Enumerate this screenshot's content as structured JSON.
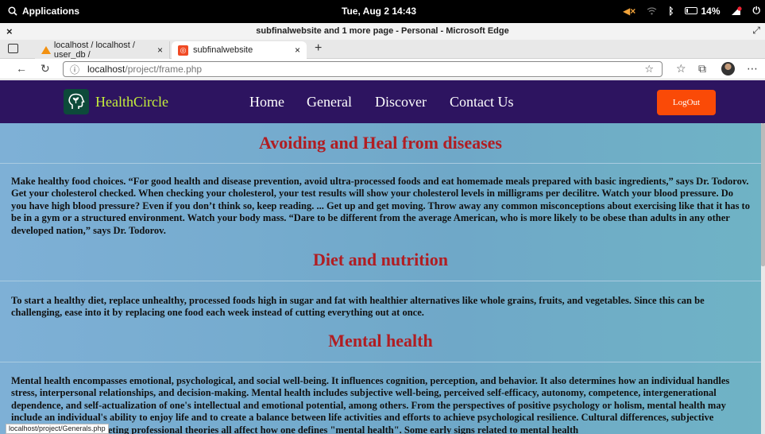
{
  "os": {
    "apps_label": "Applications",
    "datetime": "Tue, Aug 2   14:43",
    "battery": "14%"
  },
  "window": {
    "title": "subfinalwebsite and 1 more page - Personal - Microsoft Edge"
  },
  "tabs": [
    {
      "title": "localhost / localhost / user_db /"
    },
    {
      "title": "subfinalwebsite"
    }
  ],
  "address": {
    "host": "localhost",
    "path": "/project/frame.php"
  },
  "site": {
    "brand": "HealthCircle",
    "nav": [
      "Home",
      "General",
      "Discover",
      "Contact Us"
    ],
    "logout": "LogOut",
    "brand_color": "#c6ef3b",
    "nav_bg": "#2d1460",
    "accent": "#fa4a07"
  },
  "sections": [
    {
      "heading": "Avoiding and Heal from diseases",
      "body": "Make healthy food choices. “For good health and disease prevention, avoid ultra-processed foods and eat homemade meals prepared with basic ingredients,” says Dr. Todorov. Get your cholesterol checked. When checking your cholesterol, your test results will show your cholesterol levels in milligrams per decilitre. Watch your blood pressure. Do you have high blood pressure? Even if you don’t think so, keep reading. ... Get up and get moving. Throw away any common misconceptions about exercising like that it has to be in a gym or a structured environment. Watch your body mass. “Dare to be different from the average American, who is more likely to be obese than adults in any other developed nation,” says Dr. Todorov."
    },
    {
      "heading": "Diet and nutrition",
      "body": "To start a healthy diet, replace unhealthy, processed foods high in sugar and fat with healthier alternatives like whole grains, fruits, and vegetables. Since this can be challenging, ease into it by replacing one food each week instead of cutting everything out at once."
    },
    {
      "heading": "Mental health",
      "body": "Mental health encompasses emotional, psychological, and social well-being. It influences cognition, perception, and behavior. It also determines how an individual handles stress, interpersonal relationships, and decision-making. Mental health includes subjective well-being, perceived self-efficacy, autonomy, competence, intergenerational dependence, and self-actualization of one's intellectual and emotional potential, among others. From the perspectives of positive psychology or holism, mental health may include an individual's ability to enjoy life and to create a balance between life activities and efforts to achieve psychological resilience. Cultural differences, subjective assessments, and competing professional theories all affect how one defines \"mental health\". Some early signs related to mental health"
    }
  ],
  "status_link": "localhost/project/Generals.php"
}
